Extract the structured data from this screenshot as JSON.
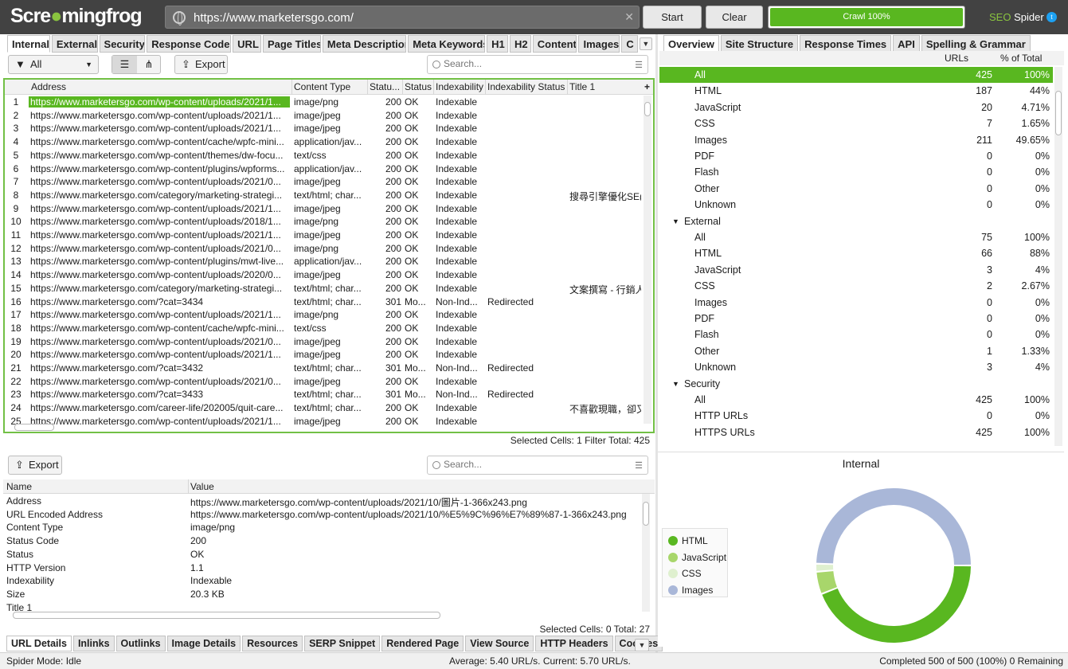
{
  "app": {
    "logo_text": "Screamingfrog",
    "product": "SEO Spider"
  },
  "toolbar": {
    "url": "https://www.marketersgo.com/",
    "start": "Start",
    "clear": "Clear",
    "crawl": "Crawl 100%",
    "crawl_progress": 100
  },
  "left_tabs": [
    "Internal",
    "External",
    "Security",
    "Response Codes",
    "URL",
    "Page Titles",
    "Meta Description",
    "Meta Keywords",
    "H1",
    "H2",
    "Content",
    "Images",
    "C"
  ],
  "filter": {
    "value": "All",
    "export": "Export",
    "search_placeholder": "Search..."
  },
  "grid": {
    "columns": [
      "Address",
      "Content Type",
      "Statu...",
      "Status",
      "Indexability",
      "Indexability Status",
      "Title 1"
    ],
    "rows": [
      [
        "1",
        "https://www.marketersgo.com/wp-content/uploads/2021/1...",
        "image/png",
        "200",
        "OK",
        "Indexable",
        "",
        ""
      ],
      [
        "2",
        "https://www.marketersgo.com/wp-content/uploads/2021/1...",
        "image/jpeg",
        "200",
        "OK",
        "Indexable",
        "",
        ""
      ],
      [
        "3",
        "https://www.marketersgo.com/wp-content/uploads/2021/1...",
        "image/jpeg",
        "200",
        "OK",
        "Indexable",
        "",
        ""
      ],
      [
        "4",
        "https://www.marketersgo.com/wp-content/cache/wpfc-mini...",
        "application/jav...",
        "200",
        "OK",
        "Indexable",
        "",
        ""
      ],
      [
        "5",
        "https://www.marketersgo.com/wp-content/themes/dw-focu...",
        "text/css",
        "200",
        "OK",
        "Indexable",
        "",
        ""
      ],
      [
        "6",
        "https://www.marketersgo.com/wp-content/plugins/wpforms...",
        "application/jav...",
        "200",
        "OK",
        "Indexable",
        "",
        ""
      ],
      [
        "7",
        "https://www.marketersgo.com/wp-content/uploads/2021/0...",
        "image/jpeg",
        "200",
        "OK",
        "Indexable",
        "",
        ""
      ],
      [
        "8",
        "https://www.marketersgo.com/category/marketing-strategi...",
        "text/html; char...",
        "200",
        "OK",
        "Indexable",
        "",
        "搜尋引擎優化SE("
      ],
      [
        "9",
        "https://www.marketersgo.com/wp-content/uploads/2021/1...",
        "image/jpeg",
        "200",
        "OK",
        "Indexable",
        "",
        ""
      ],
      [
        "10",
        "https://www.marketersgo.com/wp-content/uploads/2018/1...",
        "image/png",
        "200",
        "OK",
        "Indexable",
        "",
        ""
      ],
      [
        "11",
        "https://www.marketersgo.com/wp-content/uploads/2021/1...",
        "image/jpeg",
        "200",
        "OK",
        "Indexable",
        "",
        ""
      ],
      [
        "12",
        "https://www.marketersgo.com/wp-content/uploads/2021/0...",
        "image/png",
        "200",
        "OK",
        "Indexable",
        "",
        ""
      ],
      [
        "13",
        "https://www.marketersgo.com/wp-content/plugins/mwt-live...",
        "application/jav...",
        "200",
        "OK",
        "Indexable",
        "",
        ""
      ],
      [
        "14",
        "https://www.marketersgo.com/wp-content/uploads/2020/0...",
        "image/jpeg",
        "200",
        "OK",
        "Indexable",
        "",
        ""
      ],
      [
        "15",
        "https://www.marketersgo.com/category/marketing-strategi...",
        "text/html; char...",
        "200",
        "OK",
        "Indexable",
        "",
        "文案撰寫 - 行銷人"
      ],
      [
        "16",
        "https://www.marketersgo.com/?cat=3434",
        "text/html; char...",
        "301",
        "Mo...",
        "Non-Ind...",
        "Redirected",
        ""
      ],
      [
        "17",
        "https://www.marketersgo.com/wp-content/uploads/2021/1...",
        "image/png",
        "200",
        "OK",
        "Indexable",
        "",
        ""
      ],
      [
        "18",
        "https://www.marketersgo.com/wp-content/cache/wpfc-mini...",
        "text/css",
        "200",
        "OK",
        "Indexable",
        "",
        ""
      ],
      [
        "19",
        "https://www.marketersgo.com/wp-content/uploads/2021/0...",
        "image/jpeg",
        "200",
        "OK",
        "Indexable",
        "",
        ""
      ],
      [
        "20",
        "https://www.marketersgo.com/wp-content/uploads/2021/1...",
        "image/jpeg",
        "200",
        "OK",
        "Indexable",
        "",
        ""
      ],
      [
        "21",
        "https://www.marketersgo.com/?cat=3432",
        "text/html; char...",
        "301",
        "Mo...",
        "Non-Ind...",
        "Redirected",
        ""
      ],
      [
        "22",
        "https://www.marketersgo.com/wp-content/uploads/2021/0...",
        "image/jpeg",
        "200",
        "OK",
        "Indexable",
        "",
        ""
      ],
      [
        "23",
        "https://www.marketersgo.com/?cat=3433",
        "text/html; char...",
        "301",
        "Mo...",
        "Non-Ind...",
        "Redirected",
        ""
      ],
      [
        "24",
        "https://www.marketersgo.com/career-life/202005/quit-care...",
        "text/html; char...",
        "200",
        "OK",
        "Indexable",
        "",
        "不喜歡現職，卻又"
      ],
      [
        "25",
        "https://www.marketersgo.com/wp-content/uploads/2021/1...",
        "image/jpeg",
        "200",
        "OK",
        "Indexable",
        "",
        ""
      ]
    ],
    "status": "Selected Cells:  1  Filter Total:  425"
  },
  "detail": {
    "export": "Export",
    "search_placeholder": "Search...",
    "columns": [
      "Name",
      "Value"
    ],
    "rows": [
      [
        "Address",
        "https://www.marketersgo.com/wp-content/uploads/2021/10/圖片-1-366x243.png"
      ],
      [
        "URL Encoded Address",
        "https://www.marketersgo.com/wp-content/uploads/2021/10/%E5%9C%96%E7%89%87-1-366x243.png"
      ],
      [
        "Content Type",
        "image/png"
      ],
      [
        "Status Code",
        "200"
      ],
      [
        "Status",
        "OK"
      ],
      [
        "HTTP Version",
        "1.1"
      ],
      [
        "Indexability",
        "Indexable"
      ],
      [
        "Size",
        "20.3 KB"
      ],
      [
        "Title 1",
        ""
      ]
    ],
    "status": "Selected Cells:  0  Total:  27"
  },
  "bottom_tabs": [
    "URL Details",
    "Inlinks",
    "Outlinks",
    "Image Details",
    "Resources",
    "SERP Snippet",
    "Rendered Page",
    "View Source",
    "HTTP Headers",
    "Cookies"
  ],
  "right_tabs": [
    "Overview",
    "Site Structure",
    "Response Times",
    "API",
    "Spelling & Grammar"
  ],
  "overview": {
    "columns": [
      "URLs",
      "% of Total"
    ],
    "rows": [
      {
        "label": "All",
        "urls": "425",
        "pct": "100%",
        "level": 1,
        "sel": true
      },
      {
        "label": "HTML",
        "urls": "187",
        "pct": "44%",
        "level": 1
      },
      {
        "label": "JavaScript",
        "urls": "20",
        "pct": "4.71%",
        "level": 1
      },
      {
        "label": "CSS",
        "urls": "7",
        "pct": "1.65%",
        "level": 1
      },
      {
        "label": "Images",
        "urls": "211",
        "pct": "49.65%",
        "level": 1
      },
      {
        "label": "PDF",
        "urls": "0",
        "pct": "0%",
        "level": 1
      },
      {
        "label": "Flash",
        "urls": "0",
        "pct": "0%",
        "level": 1
      },
      {
        "label": "Other",
        "urls": "0",
        "pct": "0%",
        "level": 1
      },
      {
        "label": "Unknown",
        "urls": "0",
        "pct": "0%",
        "level": 1
      },
      {
        "label": "External",
        "urls": "",
        "pct": "",
        "level": 0
      },
      {
        "label": "All",
        "urls": "75",
        "pct": "100%",
        "level": 1
      },
      {
        "label": "HTML",
        "urls": "66",
        "pct": "88%",
        "level": 1
      },
      {
        "label": "JavaScript",
        "urls": "3",
        "pct": "4%",
        "level": 1
      },
      {
        "label": "CSS",
        "urls": "2",
        "pct": "2.67%",
        "level": 1
      },
      {
        "label": "Images",
        "urls": "0",
        "pct": "0%",
        "level": 1
      },
      {
        "label": "PDF",
        "urls": "0",
        "pct": "0%",
        "level": 1
      },
      {
        "label": "Flash",
        "urls": "0",
        "pct": "0%",
        "level": 1
      },
      {
        "label": "Other",
        "urls": "1",
        "pct": "1.33%",
        "level": 1
      },
      {
        "label": "Unknown",
        "urls": "3",
        "pct": "4%",
        "level": 1
      },
      {
        "label": "Security",
        "urls": "",
        "pct": "",
        "level": 0
      },
      {
        "label": "All",
        "urls": "425",
        "pct": "100%",
        "level": 1
      },
      {
        "label": "HTTP URLs",
        "urls": "0",
        "pct": "0%",
        "level": 1
      },
      {
        "label": "HTTPS URLs",
        "urls": "425",
        "pct": "100%",
        "level": 1
      }
    ]
  },
  "chart_data": {
    "type": "pie",
    "title": "Internal",
    "categories": [
      "HTML",
      "JavaScript",
      "CSS",
      "Images"
    ],
    "values": [
      187,
      20,
      7,
      211
    ],
    "colors": [
      "#59b720",
      "#a8d66b",
      "#dff0cf",
      "#a9b7d8"
    ],
    "legend": "left"
  },
  "footer": {
    "mode": "Spider Mode: Idle",
    "speed": "Average: 5.40 URL/s. Current: 5.70 URL/s.",
    "completed": "Completed 500 of 500 (100%) 0 Remaining"
  }
}
